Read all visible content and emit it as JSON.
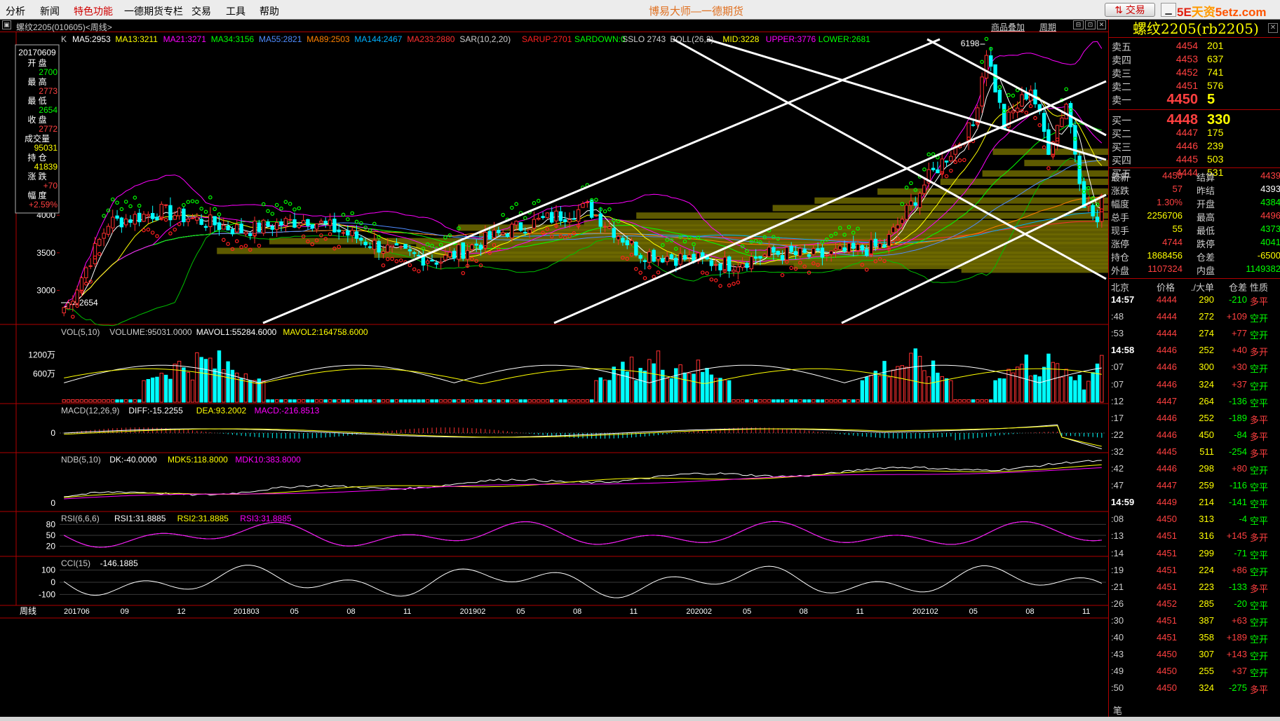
{
  "menu": {
    "items": [
      "分析",
      "新闻",
      "特色功能",
      "一德期货专栏",
      "交易",
      "工具",
      "帮助"
    ],
    "title": "博易大师—一德期货"
  },
  "window": {
    "trade_button": "交易",
    "logo_a": "5E",
    "logo_b": "天资",
    "logo_c": "5etz.com"
  },
  "toolbar": {
    "symbol": "螺纹2205(010605)<周线>",
    "overlay_label": "商品叠加",
    "period_label": "周期"
  },
  "main_legend": {
    "label": "K",
    "items": [
      {
        "text": "MA5:2953",
        "color": "#ffffff"
      },
      {
        "text": "MA13:3211",
        "color": "#ffff00"
      },
      {
        "text": "MA21:3271",
        "color": "#ff00ff"
      },
      {
        "text": "MA34:3156",
        "color": "#00ff00"
      },
      {
        "text": "MA55:2821",
        "color": "#4f8cff"
      },
      {
        "text": "MA89:2503",
        "color": "#ff8000"
      },
      {
        "text": "MA144:2467",
        "color": "#00b0ff"
      },
      {
        "text": "MA233:2880",
        "color": "#ff3030"
      },
      {
        "text": "SAR(10,2,20)",
        "color": "#cccccc"
      },
      {
        "text": "SARUP:2701",
        "color": "#ff2020"
      },
      {
        "text": "SARDOWN:0",
        "color": "#00ff00"
      },
      {
        "text": "SSLO 2743",
        "color": "#cccccc"
      },
      {
        "text": "BOLL(26,2)",
        "color": "#cccccc"
      },
      {
        "text": "MID:3228",
        "color": "#ffff00"
      },
      {
        "text": "UPPER:3776",
        "color": "#ff00ff"
      },
      {
        "text": "LOWER:2681",
        "color": "#00ff00"
      }
    ]
  },
  "info_box": {
    "date": "20170609",
    "fields": [
      {
        "label": "开  盘",
        "value": "2700",
        "color": "#00ff00"
      },
      {
        "label": "最  高",
        "value": "2773",
        "color": "#ff4040"
      },
      {
        "label": "最  低",
        "value": "2654",
        "color": "#00ff00"
      },
      {
        "label": "收  盘",
        "value": "2772",
        "color": "#ff4040"
      },
      {
        "label": "成交量",
        "value": "95031",
        "color": "#ffff00"
      },
      {
        "label": "持  仓",
        "value": "41839",
        "color": "#ffff00"
      },
      {
        "label": "涨  跌",
        "value": "+70",
        "color": "#ff4040"
      },
      {
        "label": "幅  度",
        "value": "+2.59%",
        "color": "#ff4040"
      }
    ]
  },
  "chart_data": {
    "type": "candlestick",
    "period": "weekly",
    "price_ticks": [
      "4000",
      "3500",
      "3000"
    ],
    "price_range": [
      2640,
      6250
    ],
    "annotations": [
      {
        "text": "6198",
        "kind": "peak"
      },
      {
        "text": "2654",
        "kind": "low"
      }
    ],
    "x_labels": [
      "201706",
      "09",
      "12",
      "201803",
      "05",
      "08",
      "11",
      "201902",
      "05",
      "08",
      "11",
      "202002",
      "05",
      "08",
      "11",
      "202102",
      "05",
      "08",
      "11"
    ],
    "vol_panel": {
      "legend": [
        {
          "text": "VOL(5,10)",
          "color": "#cccccc"
        },
        {
          "text": "VOLUME:95031.0000",
          "color": "#cccccc"
        },
        {
          "text": "MAVOL1:55284.6000",
          "color": "#ffffff"
        },
        {
          "text": "MAVOL2:164758.6000",
          "color": "#ffff00"
        }
      ],
      "ticks": [
        "1200万",
        "600万"
      ]
    },
    "macd_panel": {
      "legend": [
        {
          "text": "MACD(12,26,9)",
          "color": "#cccccc"
        },
        {
          "text": "DIFF:-15.2255",
          "color": "#ffffff"
        },
        {
          "text": "DEA:93.2002",
          "color": "#ffff00"
        },
        {
          "text": "MACD:-216.8513",
          "color": "#ff00ff"
        }
      ],
      "ticks": [
        "0"
      ]
    },
    "ndb_panel": {
      "legend": [
        {
          "text": "NDB(5,10)",
          "color": "#cccccc"
        },
        {
          "text": "DK:-40.0000",
          "color": "#ffffff"
        },
        {
          "text": "MDK5:118.8000",
          "color": "#ffff00"
        },
        {
          "text": "MDK10:383.8000",
          "color": "#ff00ff"
        }
      ],
      "ticks": [
        "0"
      ]
    },
    "rsi_panel": {
      "legend": [
        {
          "text": "RSI(6,6,6)",
          "color": "#cccccc"
        },
        {
          "text": "RSI1:31.8885",
          "color": "#ffffff"
        },
        {
          "text": "RSI2:31.8885",
          "color": "#ffff00"
        },
        {
          "text": "RSI3:31.8885",
          "color": "#ff00ff"
        }
      ],
      "ticks": [
        "80",
        "50",
        "20"
      ]
    },
    "cci_panel": {
      "legend": [
        {
          "text": "CCI(15)",
          "color": "#cccccc"
        },
        {
          "text": "-146.1885",
          "color": "#ffffff"
        }
      ],
      "ticks": [
        "100",
        "0",
        "-100"
      ]
    },
    "period_label": "周线"
  },
  "quote": {
    "title": "螺纹2205(rb2205)",
    "asks": [
      {
        "label": "卖五",
        "price": "4454",
        "vol": "201"
      },
      {
        "label": "卖四",
        "price": "4453",
        "vol": "637"
      },
      {
        "label": "卖三",
        "price": "4452",
        "vol": "741"
      },
      {
        "label": "卖二",
        "price": "4451",
        "vol": "576"
      },
      {
        "label": "卖一",
        "price": "4450",
        "vol": "5"
      }
    ],
    "bids": [
      {
        "label": "买一",
        "price": "4448",
        "vol": "330"
      },
      {
        "label": "买二",
        "price": "4447",
        "vol": "175"
      },
      {
        "label": "买三",
        "price": "4446",
        "vol": "239"
      },
      {
        "label": "买四",
        "price": "4445",
        "vol": "503"
      },
      {
        "label": "买五",
        "price": "4444",
        "vol": "531"
      }
    ],
    "stats": [
      {
        "l1": "最新",
        "v1": "4450",
        "c1": "#ff4040",
        "l2": "结算",
        "v2": "4439",
        "c2": "#ff4040"
      },
      {
        "l1": "涨跌",
        "v1": "57",
        "c1": "#ff4040",
        "l2": "昨结",
        "v2": "4393",
        "c2": "#ffffff"
      },
      {
        "l1": "幅度",
        "v1": "1.30%",
        "c1": "#ff4040",
        "l2": "开盘",
        "v2": "4384",
        "c2": "#00ff00"
      },
      {
        "l1": "总手",
        "v1": "2256706",
        "c1": "#ffff00",
        "l2": "最高",
        "v2": "4496",
        "c2": "#ff4040"
      },
      {
        "l1": "现手",
        "v1": "55",
        "c1": "#ffff00",
        "l2": "最低",
        "v2": "4373",
        "c2": "#00ff00"
      },
      {
        "l1": "涨停",
        "v1": "4744",
        "c1": "#ff4040",
        "l2": "跌停",
        "v2": "4041",
        "c2": "#00ff00"
      },
      {
        "l1": "持仓",
        "v1": "1868456",
        "c1": "#ffff00",
        "l2": "仓差",
        "v2": "-6500",
        "c2": "#ffff00"
      },
      {
        "l1": "外盘",
        "v1": "1107324",
        "c1": "#ff4040",
        "l2": "内盘",
        "v2": "1149382",
        "c2": "#00ff00"
      }
    ],
    "ticks_header": {
      "a": "北京",
      "b": "价格",
      "c": "./大单",
      "d": "仓差",
      "e": "性质"
    },
    "ticks": [
      {
        "t": "14:57",
        "p": "4444",
        "v": "290",
        "oi": "-210",
        "n": "多平",
        "nc": "#ff4040",
        "hl": true
      },
      {
        "t": ":48",
        "p": "4444",
        "v": "272",
        "oi": "+109",
        "n": "空开",
        "nc": "#00ff00"
      },
      {
        "t": ":53",
        "p": "4444",
        "v": "274",
        "oi": "+77",
        "n": "空开",
        "nc": "#00ff00"
      },
      {
        "t": "14:58",
        "p": "4446",
        "v": "252",
        "oi": "+40",
        "n": "多开",
        "nc": "#ff4040",
        "hl": true
      },
      {
        "t": ":07",
        "p": "4446",
        "v": "300",
        "oi": "+30",
        "n": "空开",
        "nc": "#00ff00"
      },
      {
        "t": ":07",
        "p": "4446",
        "v": "324",
        "oi": "+37",
        "n": "空开",
        "nc": "#00ff00"
      },
      {
        "t": ":12",
        "p": "4447",
        "v": "264",
        "oi": "-136",
        "n": "空平",
        "nc": "#00ff00"
      },
      {
        "t": ":17",
        "p": "4446",
        "v": "252",
        "oi": "-189",
        "n": "多平",
        "nc": "#ff4040"
      },
      {
        "t": ":22",
        "p": "4446",
        "v": "450",
        "oi": "-84",
        "n": "多平",
        "nc": "#ff4040"
      },
      {
        "t": ":32",
        "p": "4445",
        "v": "511",
        "oi": "-254",
        "n": "多平",
        "nc": "#ff4040"
      },
      {
        "t": ":42",
        "p": "4446",
        "v": "298",
        "oi": "+80",
        "n": "空开",
        "nc": "#00ff00"
      },
      {
        "t": ":47",
        "p": "4447",
        "v": "259",
        "oi": "-116",
        "n": "空平",
        "nc": "#00ff00"
      },
      {
        "t": "14:59",
        "p": "4449",
        "v": "214",
        "oi": "-141",
        "n": "空平",
        "nc": "#00ff00",
        "hl": true
      },
      {
        "t": ":08",
        "p": "4450",
        "v": "313",
        "oi": "-4",
        "n": "空平",
        "nc": "#00ff00"
      },
      {
        "t": ":13",
        "p": "4451",
        "v": "316",
        "oi": "+145",
        "n": "多开",
        "nc": "#ff4040"
      },
      {
        "t": ":14",
        "p": "4451",
        "v": "299",
        "oi": "-71",
        "n": "空平",
        "nc": "#00ff00"
      },
      {
        "t": ":19",
        "p": "4451",
        "v": "224",
        "oi": "+86",
        "n": "空开",
        "nc": "#00ff00"
      },
      {
        "t": ":21",
        "p": "4451",
        "v": "223",
        "oi": "-133",
        "n": "多平",
        "nc": "#ff4040"
      },
      {
        "t": ":26",
        "p": "4452",
        "v": "285",
        "oi": "-20",
        "n": "空平",
        "nc": "#00ff00"
      },
      {
        "t": ":30",
        "p": "4451",
        "v": "387",
        "oi": "+63",
        "n": "空开",
        "nc": "#00ff00"
      },
      {
        "t": ":40",
        "p": "4451",
        "v": "358",
        "oi": "+189",
        "n": "空开",
        "nc": "#00ff00"
      },
      {
        "t": ":43",
        "p": "4450",
        "v": "307",
        "oi": "+143",
        "n": "空开",
        "nc": "#00ff00"
      },
      {
        "t": ":49",
        "p": "4450",
        "v": "255",
        "oi": "+37",
        "n": "空开",
        "nc": "#00ff00"
      },
      {
        "t": ":50",
        "p": "4450",
        "v": "324",
        "oi": "-275",
        "n": "多平",
        "nc": "#ff4040"
      }
    ],
    "footer": "笔"
  }
}
